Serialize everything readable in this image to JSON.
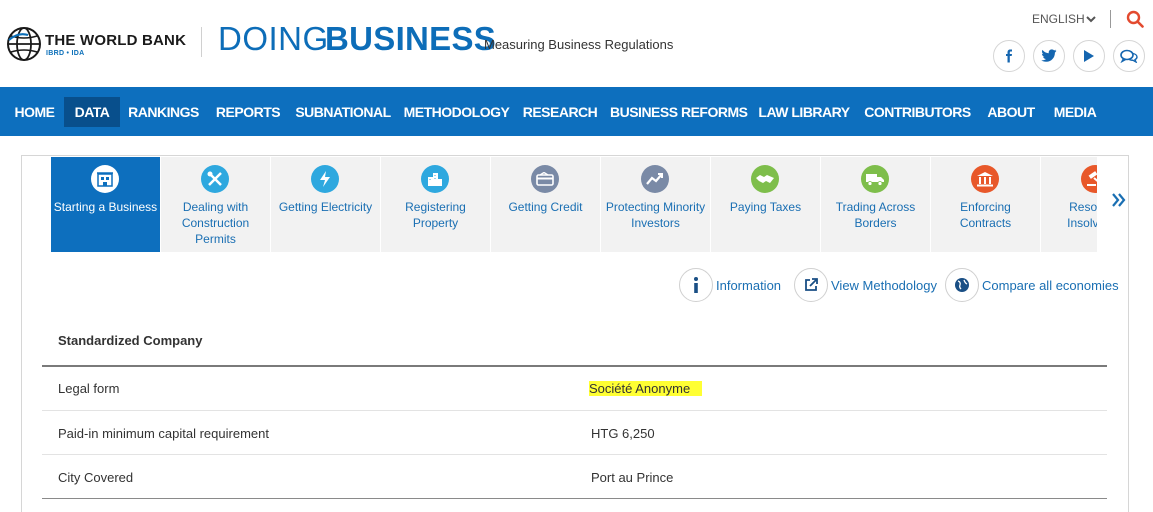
{
  "header": {
    "org_name": "THE WORLD BANK",
    "org_sub": "IBRD • IDA",
    "brand_light": "DOING",
    "brand_bold": "BUSINESS",
    "tagline": "Measuring Business Regulations",
    "language": "ENGLISH",
    "social": [
      "facebook-icon",
      "twitter-icon",
      "youtube-icon",
      "comments-icon"
    ]
  },
  "nav": {
    "items": [
      "HOME",
      "DATA",
      "RANKINGS",
      "REPORTS",
      "SUBNATIONAL",
      "METHODOLOGY",
      "RESEARCH",
      "BUSINESS REFORMS",
      "LAW LIBRARY",
      "CONTRIBUTORS",
      "ABOUT",
      "MEDIA"
    ],
    "active": "DATA"
  },
  "tabs": [
    {
      "label": "Starting a Business",
      "icon": "building-icon",
      "color": "#ffffff",
      "active": true
    },
    {
      "label": "Dealing with Construction Permits",
      "icon": "tools-icon",
      "color": "#2ea8df"
    },
    {
      "label": "Getting Electricity",
      "icon": "lightning-icon",
      "color": "#2ea8df"
    },
    {
      "label": "Registering Property",
      "icon": "city-icon",
      "color": "#2ea8df"
    },
    {
      "label": "Getting Credit",
      "icon": "credit-card-icon",
      "color": "#7a8aa6"
    },
    {
      "label": "Protecting Minority Investors",
      "icon": "trend-up-icon",
      "color": "#7a8aa6"
    },
    {
      "label": "Paying Taxes",
      "icon": "handshake-icon",
      "color": "#7ebe4b"
    },
    {
      "label": "Trading Across Borders",
      "icon": "truck-icon",
      "color": "#7ebe4b"
    },
    {
      "label": "Enforcing Contracts",
      "icon": "courthouse-icon",
      "color": "#e8582a"
    },
    {
      "label": "Resolving Insolvency",
      "icon": "gavel-icon",
      "color": "#e8582a"
    }
  ],
  "actions": {
    "information": "Information",
    "view_methodology": "View Methodology",
    "compare": "Compare all economies"
  },
  "table": {
    "heading": "Standardized Company",
    "rows": [
      {
        "label": "Legal form",
        "value": "Société Anonyme",
        "highlighted": true
      },
      {
        "label": "Paid-in minimum capital requirement",
        "value": "HTG 6,250"
      },
      {
        "label": "City Covered",
        "value": "Port au Prince"
      }
    ]
  }
}
